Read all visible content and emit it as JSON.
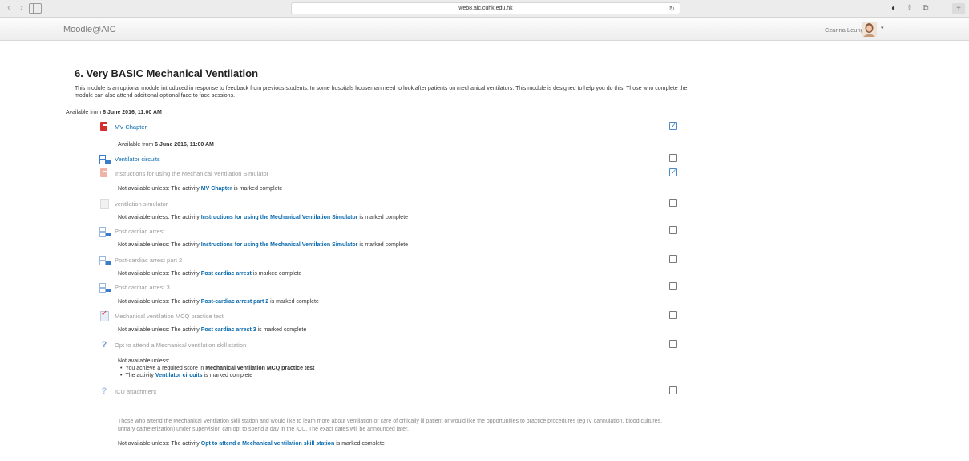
{
  "browser": {
    "url": "web8.aic.cuhk.edu.hk",
    "back_glyph": "‹",
    "forward_glyph": "›",
    "reload_glyph": "↻",
    "reader_glyph": "◐",
    "share_glyph": "⇪",
    "tabs_glyph": "⧉",
    "newtab_glyph": "+"
  },
  "nav": {
    "brand": "Moodle@AIC",
    "user_name": "Czarina Leung",
    "menu_caret": "▾"
  },
  "section": {
    "title": "6. Very BASIC Mechanical Ventilation",
    "summary": "This module is an optional module introduced in response to feedback from previous students. In some hospitals houseman need to look after patients on mechanical ventilators. This module is designed to help you do this. Those who complete the module can also attend additional optional face to face sessions.",
    "available_prefix": "Available from ",
    "available_date": "6 June 2016, 11:00 AM"
  },
  "activities": [
    {
      "name": "MV Chapter",
      "icon": "pdf-icon",
      "completed": true,
      "availability": {
        "prefix": "Available from ",
        "bold": "6 June 2016, 11:00 AM"
      }
    },
    {
      "name": "Ventilator circuits",
      "icon": "lesson-icon",
      "completed": false
    },
    {
      "name": "Instructions for using the Mechanical Ventilation Simulator",
      "icon": "pdf-icon",
      "completed": true,
      "availability": {
        "prefix": "Not available unless: The activity ",
        "link": "MV Chapter",
        "suffix": " is marked complete"
      }
    },
    {
      "name": "ventilation simulator",
      "icon": "page-icon",
      "completed": false,
      "availability": {
        "prefix": "Not available unless: The activity ",
        "link": "Instructions for using the Mechanical Ventilation Simulator",
        "suffix": " is marked complete"
      }
    },
    {
      "name": "Post cardiac arrest",
      "icon": "lesson-icon",
      "completed": false,
      "availability": {
        "prefix": "Not available unless: The activity ",
        "link": "Instructions for using the Mechanical Ventilation Simulator",
        "suffix": " is marked complete"
      }
    },
    {
      "name": "Post-cardiac arrest part 2",
      "icon": "lesson-icon",
      "completed": false,
      "availability": {
        "prefix": "Not available unless: The activity ",
        "link": "Post cardiac arrest",
        "suffix": " is marked complete"
      }
    },
    {
      "name": "Post cardiac arrest 3",
      "icon": "lesson-icon",
      "completed": false,
      "availability": {
        "prefix": "Not available unless: The activity ",
        "link": "Post-cardiac arrest part 2",
        "suffix": " is marked complete"
      }
    },
    {
      "name": "Mechanical ventilation MCQ practice test",
      "icon": "quiz-icon",
      "completed": false,
      "availability": {
        "prefix": "Not available unless: The activity ",
        "link": "Post cardiac arrest 3",
        "suffix": " is marked complete"
      }
    },
    {
      "name": "Opt to attend a Mechanical ventilation skill station",
      "icon": "question-icon",
      "completed": false,
      "availability_multi": {
        "heading": "Not available unless:",
        "item1_prefix": "You achieve a required score in ",
        "item1_bold": "Mechanical ventilation MCQ practice test",
        "item2_prefix": "The activity ",
        "item2_link": "Ventilator circuits",
        "item2_suffix": " is marked complete"
      }
    },
    {
      "name": "ICU attachment",
      "icon": "question-icon",
      "completed": false,
      "description": "Those who attend the Mechanical Ventilation skill station and would like to learn more about ventilation or care of critically ill patient or would like the opportunities to practice procedures (eg IV cannulation, blood cultures, urinary catheterization) under supervision can opt to spend a day in the ICU. The exact dates will be announced later.",
      "availability": {
        "prefix": "Not available unless: The activity ",
        "link": "Opt to attend a Mechanical ventilation skill station",
        "suffix": " is marked complete"
      }
    }
  ],
  "colors": {
    "link": "#0a6aad",
    "dim_text": "#9a9a9a",
    "check_blue": "#4a8ac8"
  }
}
